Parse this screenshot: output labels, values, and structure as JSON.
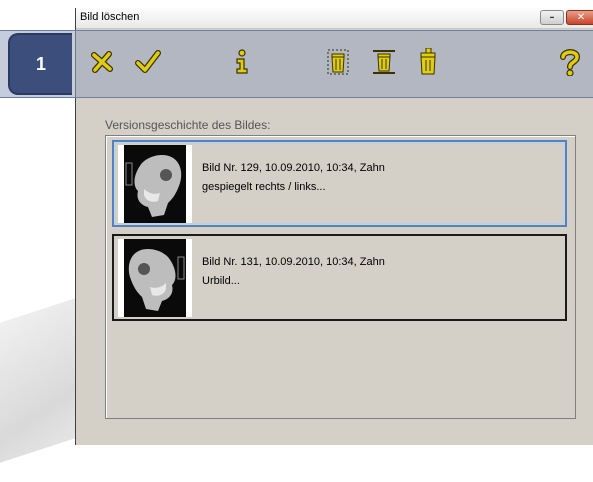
{
  "window": {
    "title": "Bild löschen"
  },
  "callout": {
    "number": "1"
  },
  "toolbar": {
    "items": [
      {
        "icon": "cancel-x-icon"
      },
      {
        "icon": "confirm-check-icon"
      },
      {
        "icon": "info-icon"
      },
      {
        "icon": "delete-trash-icon"
      },
      {
        "icon": "delete-selected-trash-icon"
      },
      {
        "icon": "delete-all-trash-icon"
      },
      {
        "icon": "help-icon"
      }
    ]
  },
  "history": {
    "label": "Versionsgeschichte des Bildes:",
    "entries": [
      {
        "line1": "Bild Nr. 129, 10.09.2010, 10:34, Zahn",
        "line2": "gespiegelt rechts / links...",
        "selected": true
      },
      {
        "line1": "Bild Nr. 131, 10.09.2010, 10:34, Zahn",
        "line2": "Urbild...",
        "selected": false
      }
    ]
  },
  "colors": {
    "accent": "#4f83c3",
    "callout": "#3c4f7c",
    "toolbar_highlight": "#96a3be",
    "icon_yellow": "#d4c000"
  }
}
